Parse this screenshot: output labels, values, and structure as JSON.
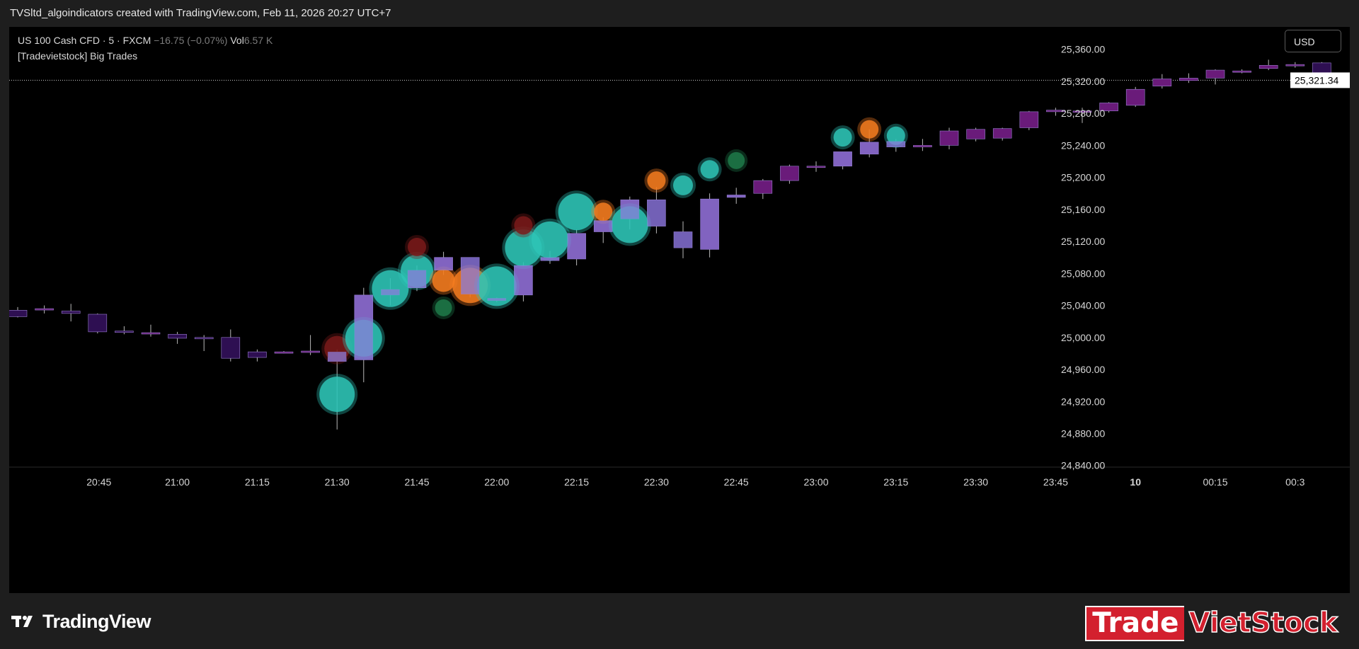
{
  "header": {
    "caption": "TVSltd_algoindicators created with TradingView.com, Feb 11, 2026 20:27 UTC+7"
  },
  "legend": {
    "symbol": "US 100 Cash CFD · 5 · FXCM",
    "change": "−16.75 (−0.07%)",
    "vol_label": "Vol",
    "vol_value": "6.57 K",
    "indicator": "[Tradevietstock] Big Trades"
  },
  "currency_button": "USD",
  "footer": {
    "tradingview_logo": "TradingView",
    "brand_part1": "Trade",
    "brand_part2": "VietStock"
  },
  "colors": {
    "background": "#000000",
    "candle_fill": "#6a1b7a",
    "candle_alt": "#2e0f52",
    "bubble_buy": "#2ec4b6",
    "bubble_sell": "#f57c20",
    "bubble_buy_small": "#1e7a4a",
    "bubble_sell_small": "#7a1a1a",
    "bubble_overlap": "#8a7cd8"
  },
  "chart_data": {
    "type": "candlestick",
    "y_ticks": [
      "25,360.00",
      "25,320.00",
      "25,280.00",
      "25,240.00",
      "25,200.00",
      "25,160.00",
      "25,120.00",
      "25,080.00",
      "25,040.00",
      "25,000.00",
      "24,960.00",
      "24,920.00",
      "24,880.00",
      "24,840.00"
    ],
    "y_tick_values": [
      25360,
      25320,
      25280,
      25240,
      25200,
      25160,
      25120,
      25080,
      25040,
      25000,
      24960,
      24920,
      24880,
      24840
    ],
    "ylim": [
      24838,
      25388
    ],
    "x_ticks": [
      "20:45",
      "21:00",
      "21:15",
      "21:30",
      "21:45",
      "22:00",
      "22:15",
      "22:30",
      "22:45",
      "23:00",
      "23:15",
      "23:30",
      "23:45",
      "10",
      "00:15",
      "00:3"
    ],
    "x_tick_slots": [
      3,
      6,
      9,
      12,
      15,
      18,
      21,
      24,
      27,
      30,
      33,
      36,
      39,
      42,
      45,
      48
    ],
    "last_price": "25,321.34",
    "last_price_value": 25321.34,
    "candles": [
      {
        "o": 25034,
        "h": 25038,
        "l": 25025,
        "c": 25026
      },
      {
        "o": 25035,
        "h": 25040,
        "l": 25030,
        "c": 25036
      },
      {
        "o": 25033,
        "h": 25042,
        "l": 25020,
        "c": 25030
      },
      {
        "o": 25029,
        "h": 25030,
        "l": 25005,
        "c": 25007
      },
      {
        "o": 25008,
        "h": 25014,
        "l": 25004,
        "c": 25007
      },
      {
        "o": 25005,
        "h": 25016,
        "l": 25001,
        "c": 25006
      },
      {
        "o": 25004,
        "h": 25007,
        "l": 24992,
        "c": 24999
      },
      {
        "o": 25000,
        "h": 25003,
        "l": 24983,
        "c": 24999
      },
      {
        "o": 25000,
        "h": 25010,
        "l": 24970,
        "c": 24974
      },
      {
        "o": 24982,
        "h": 24985,
        "l": 24970,
        "c": 24975
      },
      {
        "o": 24982,
        "h": 24983,
        "l": 24980,
        "c": 24982
      },
      {
        "o": 24983,
        "h": 25003,
        "l": 24978,
        "c": 24983
      },
      {
        "o": 24982,
        "h": 24985,
        "l": 24885,
        "c": 24970
      },
      {
        "o": 24972,
        "h": 25062,
        "l": 24944,
        "c": 25053
      },
      {
        "o": 25053,
        "h": 25074,
        "l": 25040,
        "c": 25060
      },
      {
        "o": 25062,
        "h": 25090,
        "l": 25058,
        "c": 25084
      },
      {
        "o": 25084,
        "h": 25107,
        "l": 25078,
        "c": 25100
      },
      {
        "o": 25100,
        "h": 25100,
        "l": 25050,
        "c": 25054
      },
      {
        "o": 25049,
        "h": 25050,
        "l": 25044,
        "c": 25046
      },
      {
        "o": 25053,
        "h": 25094,
        "l": 25045,
        "c": 25090
      },
      {
        "o": 25096,
        "h": 25108,
        "l": 25092,
        "c": 25100
      },
      {
        "o": 25098,
        "h": 25135,
        "l": 25090,
        "c": 25130
      },
      {
        "o": 25132,
        "h": 25150,
        "l": 25118,
        "c": 25146
      },
      {
        "o": 25148,
        "h": 25176,
        "l": 25135,
        "c": 25172
      },
      {
        "o": 25172,
        "h": 25188,
        "l": 25130,
        "c": 25139
      },
      {
        "o": 25132,
        "h": 25145,
        "l": 25099,
        "c": 25112
      },
      {
        "o": 25110,
        "h": 25180,
        "l": 25100,
        "c": 25173
      },
      {
        "o": 25175,
        "h": 25187,
        "l": 25167,
        "c": 25178
      },
      {
        "o": 25180,
        "h": 25198,
        "l": 25173,
        "c": 25196
      },
      {
        "o": 25196,
        "h": 25216,
        "l": 25192,
        "c": 25214
      },
      {
        "o": 25213,
        "h": 25220,
        "l": 25207,
        "c": 25214
      },
      {
        "o": 25214,
        "h": 25232,
        "l": 25210,
        "c": 25232
      },
      {
        "o": 25229,
        "h": 25260,
        "l": 25225,
        "c": 25244
      },
      {
        "o": 25245,
        "h": 25248,
        "l": 25232,
        "c": 25238
      },
      {
        "o": 25238,
        "h": 25248,
        "l": 25233,
        "c": 25240
      },
      {
        "o": 25240,
        "h": 25262,
        "l": 25235,
        "c": 25258
      },
      {
        "o": 25248,
        "h": 25262,
        "l": 25245,
        "c": 25260
      },
      {
        "o": 25249,
        "h": 25262,
        "l": 25246,
        "c": 25261
      },
      {
        "o": 25262,
        "h": 25283,
        "l": 25259,
        "c": 25282
      },
      {
        "o": 25282,
        "h": 25287,
        "l": 25277,
        "c": 25284
      },
      {
        "o": 25282,
        "h": 25287,
        "l": 25268,
        "c": 25283
      },
      {
        "o": 25283,
        "h": 25294,
        "l": 25281,
        "c": 25293
      },
      {
        "o": 25290,
        "h": 25313,
        "l": 25288,
        "c": 25310
      },
      {
        "o": 25314,
        "h": 25329,
        "l": 25311,
        "c": 25323
      },
      {
        "o": 25321,
        "h": 25330,
        "l": 25318,
        "c": 25324
      },
      {
        "o": 25324,
        "h": 25335,
        "l": 25316,
        "c": 25334
      },
      {
        "o": 25333,
        "h": 25335,
        "l": 25330,
        "c": 25333
      },
      {
        "o": 25336,
        "h": 25347,
        "l": 25334,
        "c": 25340
      },
      {
        "o": 25340,
        "h": 25344,
        "l": 25337,
        "c": 25341
      },
      {
        "o": 25343,
        "h": 25344,
        "l": 25321,
        "c": 25321
      }
    ],
    "bubbles": [
      {
        "slot": 12,
        "price": 24929,
        "size": 25,
        "kind": "buy"
      },
      {
        "slot": 12,
        "price": 24986,
        "size": 18,
        "kind": "sell_small"
      },
      {
        "slot": 13,
        "price": 24999,
        "size": 26,
        "kind": "buy"
      },
      {
        "slot": 14,
        "price": 25061,
        "size": 26,
        "kind": "buy"
      },
      {
        "slot": 15,
        "price": 25083,
        "size": 23,
        "kind": "buy"
      },
      {
        "slot": 15,
        "price": 25113,
        "size": 13,
        "kind": "sell_small"
      },
      {
        "slot": 16,
        "price": 25071,
        "size": 16,
        "kind": "sell"
      },
      {
        "slot": 16,
        "price": 25037,
        "size": 12,
        "kind": "buy_small"
      },
      {
        "slot": 17,
        "price": 25065,
        "size": 25,
        "kind": "sell"
      },
      {
        "slot": 18,
        "price": 25064,
        "size": 28,
        "kind": "buy"
      },
      {
        "slot": 19,
        "price": 25112,
        "size": 26,
        "kind": "buy"
      },
      {
        "slot": 19,
        "price": 25140,
        "size": 13,
        "kind": "sell_small"
      },
      {
        "slot": 20,
        "price": 25122,
        "size": 26,
        "kind": "buy"
      },
      {
        "slot": 21,
        "price": 25157,
        "size": 26,
        "kind": "buy"
      },
      {
        "slot": 22,
        "price": 25157,
        "size": 13,
        "kind": "sell"
      },
      {
        "slot": 23,
        "price": 25141,
        "size": 26,
        "kind": "buy"
      },
      {
        "slot": 24,
        "price": 25196,
        "size": 13,
        "kind": "sell"
      },
      {
        "slot": 25,
        "price": 25190,
        "size": 14,
        "kind": "buy"
      },
      {
        "slot": 26,
        "price": 25210,
        "size": 13,
        "kind": "buy"
      },
      {
        "slot": 27,
        "price": 25221,
        "size": 12,
        "kind": "buy_small"
      },
      {
        "slot": 31,
        "price": 25250,
        "size": 13,
        "kind": "buy"
      },
      {
        "slot": 32,
        "price": 25260,
        "size": 13,
        "kind": "sell"
      },
      {
        "slot": 33,
        "price": 25252,
        "size": 13,
        "kind": "buy"
      }
    ]
  }
}
